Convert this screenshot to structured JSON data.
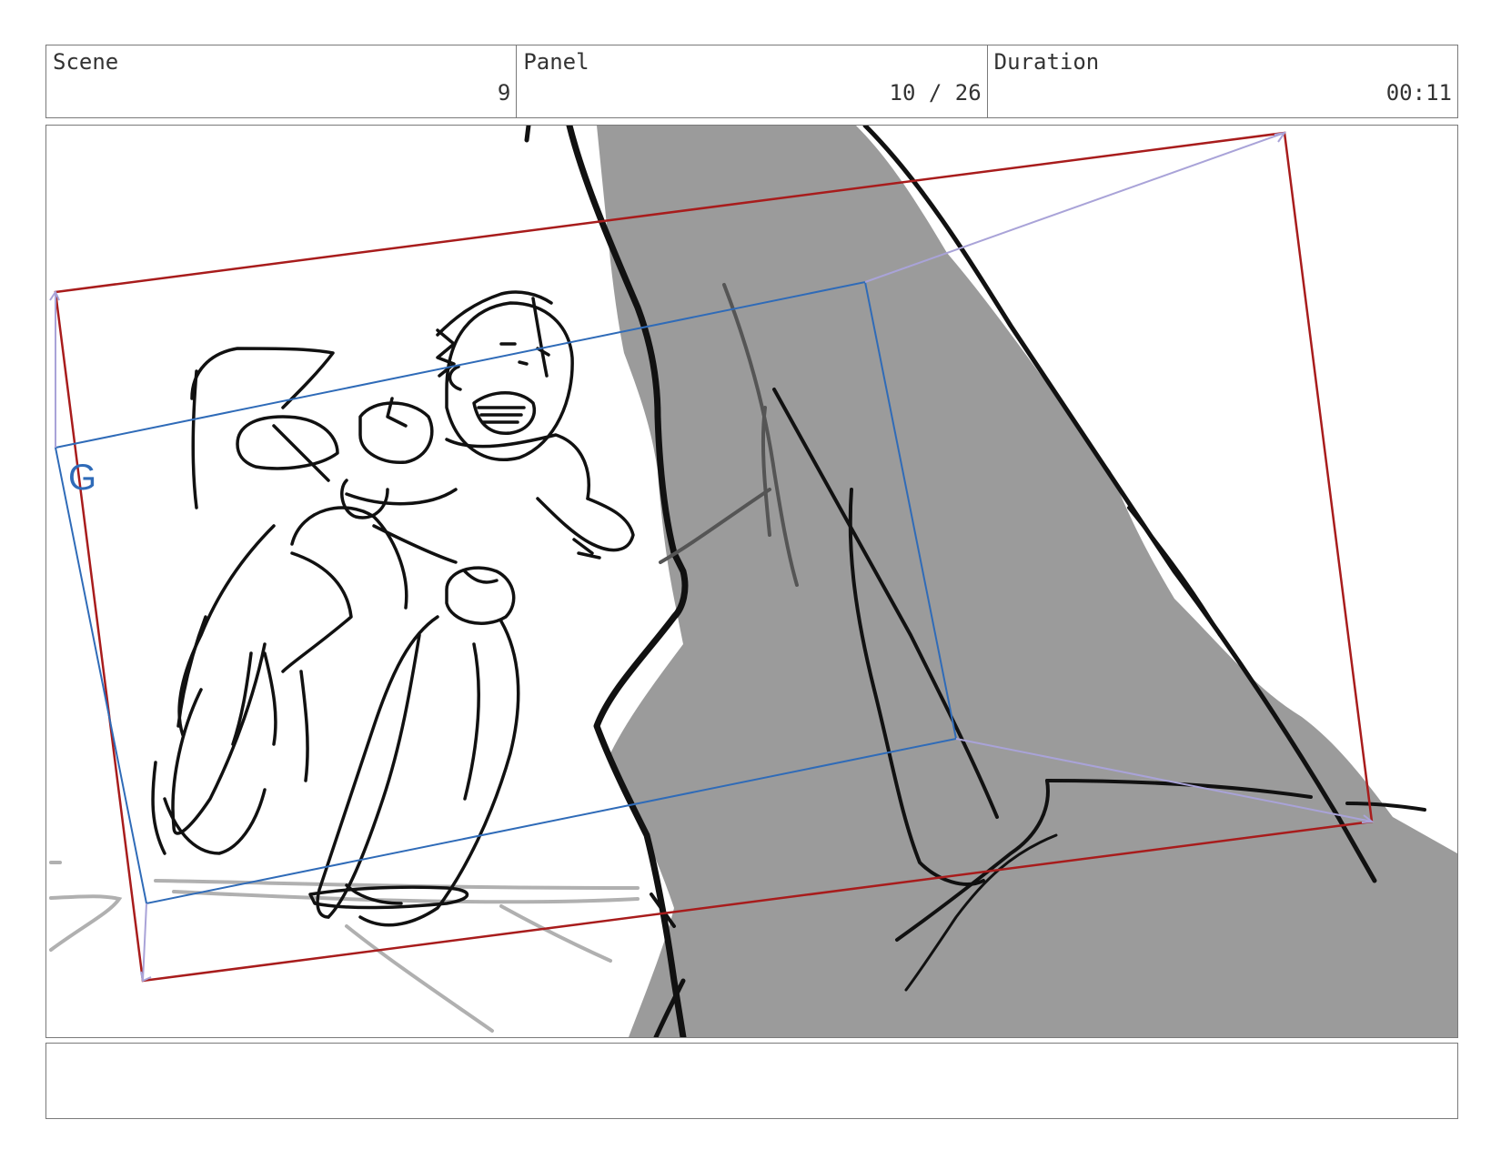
{
  "header": {
    "scene_label": "Scene",
    "scene_value": "9",
    "panel_label": "Panel",
    "panel_value": "10 / 26",
    "duration_label": "Duration",
    "duration_value": "00:11"
  },
  "drawing": {
    "camera_guide_letter": "G",
    "colors": {
      "frame_outer": "#a81c1c",
      "frame_inner": "#2f6bb8",
      "perspective_lines": "#a9a3d8",
      "rock_fill": "#9b9b9b",
      "ink": "#111111"
    }
  },
  "notes": {
    "text": ""
  }
}
